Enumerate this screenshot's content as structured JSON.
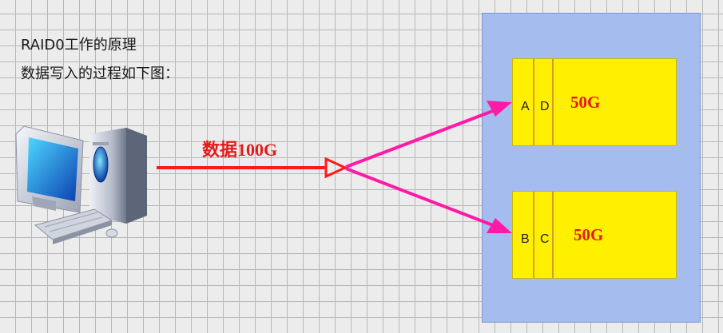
{
  "captions": {
    "line1": "RAID0工作的原理",
    "line2": "数据写入的过程如下图："
  },
  "data_label": "数据100G",
  "disks": [
    {
      "blocks": [
        "A",
        "D"
      ],
      "capacity": "50G"
    },
    {
      "blocks": [
        "B",
        "C"
      ],
      "capacity": "50G"
    }
  ],
  "colors": {
    "arrow_main": "#ff1a1a",
    "arrow_split": "#ff1aa8",
    "array_bg": "#a4bcee",
    "disk_bg": "#fff000"
  },
  "icons": [
    "computer-icon"
  ]
}
